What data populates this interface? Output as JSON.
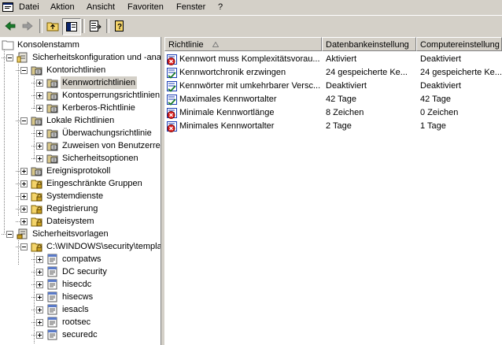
{
  "menubar": {
    "items": [
      {
        "label": "Datei",
        "key": "datei"
      },
      {
        "label": "Aktion",
        "key": "aktion"
      },
      {
        "label": "Ansicht",
        "key": "ansicht"
      },
      {
        "label": "Favoriten",
        "key": "favoriten"
      },
      {
        "label": "Fenster",
        "key": "fenster"
      },
      {
        "label": "?",
        "key": "help"
      }
    ]
  },
  "toolbar": {
    "buttons": [
      "back-arrow-icon",
      "forward-arrow-icon",
      "up-folder-icon",
      "show-tree-icon",
      "export-list-icon",
      "help-book-icon"
    ]
  },
  "tree": {
    "root_label": "Konsolenstamm",
    "items": [
      {
        "label": "Sicherheitskonfiguration und -anal",
        "level": 1,
        "expander": "minus",
        "icon": "security-config-icon"
      },
      {
        "label": "Kontorichtlinien",
        "level": 2,
        "expander": "minus",
        "icon": "policy-folder-icon"
      },
      {
        "label": "Kennwortrichtlinien",
        "level": 3,
        "expander": "plus",
        "icon": "policy-folder-icon",
        "selected": true
      },
      {
        "label": "Kontosperrungsrichtlinien",
        "level": 3,
        "expander": "plus",
        "icon": "policy-folder-icon"
      },
      {
        "label": "Kerberos-Richtlinie",
        "level": 3,
        "expander": "plus",
        "icon": "policy-folder-icon"
      },
      {
        "label": "Lokale Richtlinien",
        "level": 2,
        "expander": "minus",
        "icon": "policy-folder-icon"
      },
      {
        "label": "Überwachungsrichtlinie",
        "level": 3,
        "expander": "plus",
        "icon": "policy-folder-icon"
      },
      {
        "label": "Zuweisen von Benutzerrec",
        "level": 3,
        "expander": "plus",
        "icon": "policy-folder-icon"
      },
      {
        "label": "Sicherheitsoptionen",
        "level": 3,
        "expander": "plus",
        "icon": "policy-folder-icon"
      },
      {
        "label": "Ereignisprotokoll",
        "level": 2,
        "expander": "plus",
        "icon": "policy-folder-icon"
      },
      {
        "label": "Eingeschränkte Gruppen",
        "level": 2,
        "expander": "plus",
        "icon": "lock-folder-icon"
      },
      {
        "label": "Systemdienste",
        "level": 2,
        "expander": "plus",
        "icon": "lock-folder-icon"
      },
      {
        "label": "Registrierung",
        "level": 2,
        "expander": "plus",
        "icon": "lock-folder-icon"
      },
      {
        "label": "Dateisystem",
        "level": 2,
        "expander": "plus",
        "icon": "lock-folder-icon"
      },
      {
        "label": "Sicherheitsvorlagen",
        "level": 1,
        "expander": "minus",
        "icon": "security-templates-icon"
      },
      {
        "label": "C:\\WINDOWS\\security\\templa",
        "level": 2,
        "expander": "minus",
        "icon": "lock-folder-icon"
      },
      {
        "label": "compatws",
        "level": 3,
        "expander": "plus",
        "icon": "template-icon"
      },
      {
        "label": "DC security",
        "level": 3,
        "expander": "plus",
        "icon": "template-icon"
      },
      {
        "label": "hisecdc",
        "level": 3,
        "expander": "plus",
        "icon": "template-icon"
      },
      {
        "label": "hisecws",
        "level": 3,
        "expander": "plus",
        "icon": "template-icon"
      },
      {
        "label": "iesacls",
        "level": 3,
        "expander": "plus",
        "icon": "template-icon"
      },
      {
        "label": "rootsec",
        "level": 3,
        "expander": "plus",
        "icon": "template-icon"
      },
      {
        "label": "securedc",
        "level": 3,
        "expander": "plus",
        "icon": "template-icon"
      }
    ]
  },
  "list": {
    "columns": [
      "Richtlinie",
      "Datenbankeinstellung",
      "Computereinstellung"
    ],
    "rows": [
      {
        "name": "Kennwort muss Komplexitätsvorau...",
        "db": "Aktiviert",
        "comp": "Deaktiviert",
        "icon": "policy-error-icon"
      },
      {
        "name": "Kennwortchronik erzwingen",
        "db": "24 gespeicherte Ke...",
        "comp": "24 gespeicherte Ke...",
        "icon": "policy-ok-icon"
      },
      {
        "name": "Kennwörter mit umkehrbarer Versc...",
        "db": "Deaktiviert",
        "comp": "Deaktiviert",
        "icon": "policy-ok-icon"
      },
      {
        "name": "Maximales Kennwortalter",
        "db": "42 Tage",
        "comp": "42 Tage",
        "icon": "policy-ok-icon"
      },
      {
        "name": "Minimale Kennwortlänge",
        "db": "8 Zeichen",
        "comp": "0 Zeichen",
        "icon": "policy-error-icon"
      },
      {
        "name": "Minimales Kennwortalter",
        "db": "2 Tage",
        "comp": "1 Tage",
        "icon": "policy-error-icon"
      }
    ]
  },
  "colors": {
    "selection": "#d4d0c8",
    "error": "#e02020",
    "ok": "#1b3fb5"
  }
}
